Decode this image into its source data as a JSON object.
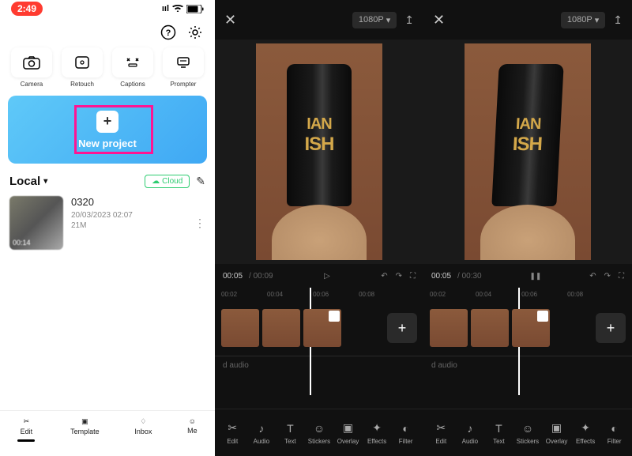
{
  "status": {
    "time": "2:49"
  },
  "topTools": [
    {
      "label": "Camera"
    },
    {
      "label": "Retouch"
    },
    {
      "label": "Captions"
    },
    {
      "label": "Prompter"
    }
  ],
  "newProject": {
    "label": "New project"
  },
  "local": {
    "title": "Local",
    "cloud": "Cloud"
  },
  "project": {
    "title": "0320",
    "date": "20/03/2023 02:07",
    "size": "21M",
    "duration": "00:14"
  },
  "nav": [
    {
      "label": "Edit"
    },
    {
      "label": "Template"
    },
    {
      "label": "Inbox"
    },
    {
      "label": "Me"
    }
  ],
  "editor": {
    "resolution": "1080P",
    "ruler": [
      "00:02",
      "00:04",
      "00:06",
      "00:08"
    ],
    "tools": [
      {
        "label": "Edit"
      },
      {
        "label": "Audio"
      },
      {
        "label": "Text"
      },
      {
        "label": "Stickers"
      },
      {
        "label": "Overlay"
      },
      {
        "label": "Effects"
      },
      {
        "label": "Filter"
      }
    ],
    "cup": {
      "line1": "IAN",
      "line2": "ISH"
    },
    "audio_label": "d audio"
  },
  "panel2": {
    "current": "00:05",
    "total": "00:09",
    "play_glyph": "▷"
  },
  "panel3": {
    "current": "00:05",
    "total": "00:30",
    "play_glyph": "❚❚"
  }
}
